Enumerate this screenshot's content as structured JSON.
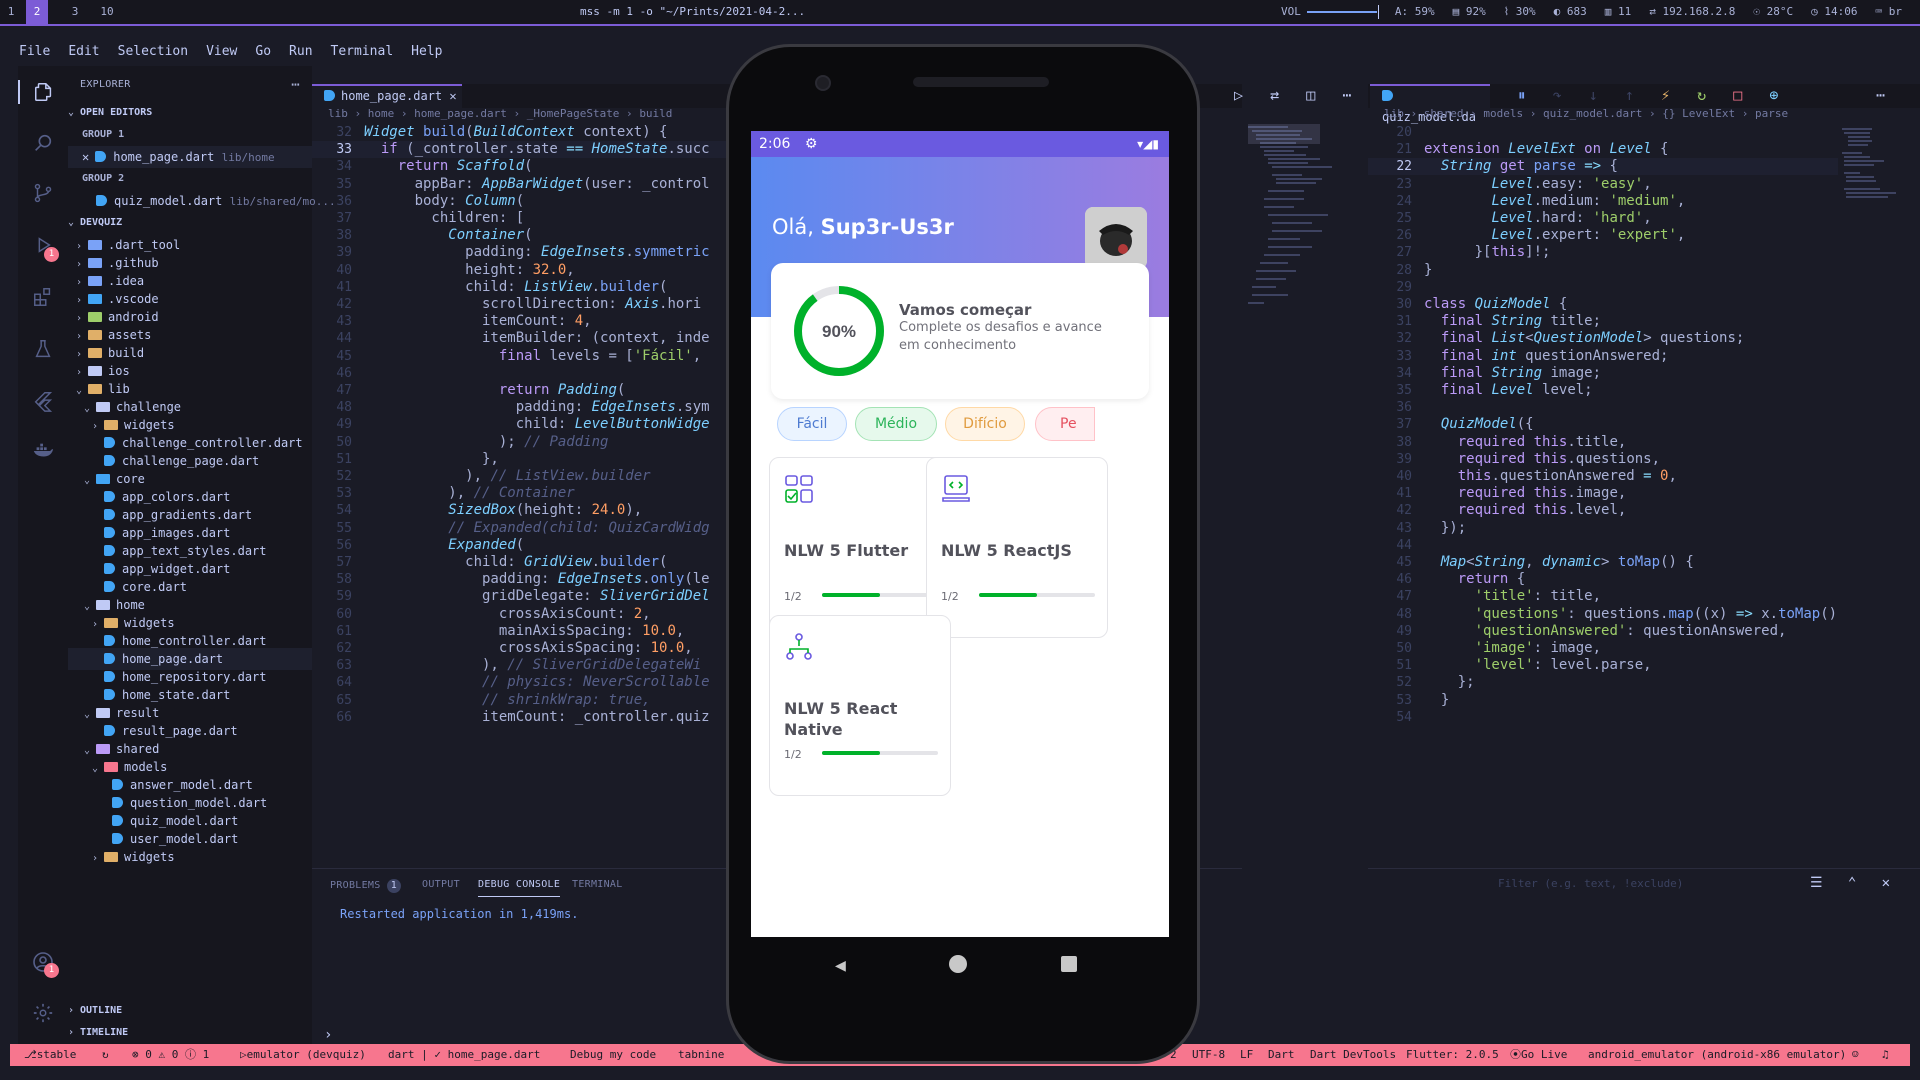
{
  "topbar": {
    "workspaces": [
      "1",
      "2",
      "3",
      "10"
    ],
    "active_workspace": "2",
    "title": "mss -m 1 -o \"~/Prints/2021-04-2...",
    "vol_label": "VOL",
    "stats": [
      "A: 59%",
      "▤ 92%",
      "⌇ 30%",
      "◐ 683",
      "▥ 11",
      "⇄ 192.168.2.8",
      "☉ 28°C",
      "◷ 14:06",
      "⌨ br"
    ]
  },
  "menu": [
    "File",
    "Edit",
    "Selection",
    "View",
    "Go",
    "Run",
    "Terminal",
    "Help"
  ],
  "activity": {
    "scm_badge": "",
    "run_badge": "1",
    "account_badge": "1"
  },
  "explorer": {
    "title": "EXPLORER",
    "open_editors": "OPEN EDITORS",
    "group1": "GROUP 1",
    "group1_file": "home_page.dart",
    "group1_path": "lib/home",
    "group2": "GROUP 2",
    "group2_file": "quiz_model.dart",
    "group2_path": "lib/shared/mo...",
    "project": "DEVQUIZ",
    "tree": [
      {
        "label": ".dart_tool",
        "kind": "folder",
        "depth": 1,
        "open": false
      },
      {
        "label": ".github",
        "kind": "folder",
        "depth": 1,
        "open": false
      },
      {
        "label": ".idea",
        "kind": "folder",
        "depth": 1,
        "open": false
      },
      {
        "label": ".vscode",
        "kind": "folder",
        "depth": 1,
        "open": false
      },
      {
        "label": "android",
        "kind": "folder",
        "depth": 1,
        "open": false
      },
      {
        "label": "assets",
        "kind": "folder",
        "depth": 1,
        "open": false
      },
      {
        "label": "build",
        "kind": "folder",
        "depth": 1,
        "open": false
      },
      {
        "label": "ios",
        "kind": "folder",
        "depth": 1,
        "open": false
      },
      {
        "label": "lib",
        "kind": "folder",
        "depth": 1,
        "open": true
      },
      {
        "label": "challenge",
        "kind": "folder",
        "depth": 2,
        "open": true
      },
      {
        "label": "widgets",
        "kind": "folder",
        "depth": 3,
        "open": false
      },
      {
        "label": "challenge_controller.dart",
        "kind": "dart",
        "depth": 3
      },
      {
        "label": "challenge_page.dart",
        "kind": "dart",
        "depth": 3
      },
      {
        "label": "core",
        "kind": "folder",
        "depth": 2,
        "open": true
      },
      {
        "label": "app_colors.dart",
        "kind": "dart",
        "depth": 3
      },
      {
        "label": "app_gradients.dart",
        "kind": "dart",
        "depth": 3
      },
      {
        "label": "app_images.dart",
        "kind": "dart",
        "depth": 3
      },
      {
        "label": "app_text_styles.dart",
        "kind": "dart",
        "depth": 3
      },
      {
        "label": "app_widget.dart",
        "kind": "dart",
        "depth": 3
      },
      {
        "label": "core.dart",
        "kind": "dart",
        "depth": 3
      },
      {
        "label": "home",
        "kind": "folder",
        "depth": 2,
        "open": true
      },
      {
        "label": "widgets",
        "kind": "folder",
        "depth": 3,
        "open": false
      },
      {
        "label": "home_controller.dart",
        "kind": "dart",
        "depth": 3
      },
      {
        "label": "home_page.dart",
        "kind": "dart",
        "depth": 3,
        "selected": true
      },
      {
        "label": "home_repository.dart",
        "kind": "dart",
        "depth": 3
      },
      {
        "label": "home_state.dart",
        "kind": "dart",
        "depth": 3
      },
      {
        "label": "result",
        "kind": "folder",
        "depth": 2,
        "open": true
      },
      {
        "label": "result_page.dart",
        "kind": "dart",
        "depth": 3
      },
      {
        "label": "shared",
        "kind": "folder",
        "depth": 2,
        "open": true
      },
      {
        "label": "models",
        "kind": "folder",
        "depth": 3,
        "open": true
      },
      {
        "label": "answer_model.dart",
        "kind": "dart",
        "depth": 4
      },
      {
        "label": "question_model.dart",
        "kind": "dart",
        "depth": 4
      },
      {
        "label": "quiz_model.dart",
        "kind": "dart",
        "depth": 4
      },
      {
        "label": "user_model.dart",
        "kind": "dart",
        "depth": 4
      },
      {
        "label": "widgets",
        "kind": "folder",
        "depth": 3,
        "open": false
      }
    ],
    "outline": "OUTLINE",
    "timeline": "TIMELINE"
  },
  "editor1": {
    "tab": "home_page.dart",
    "breadcrumb": [
      "lib",
      "home",
      "home_page.dart",
      "_HomePageState",
      "build"
    ],
    "current_line": "33",
    "lines": [
      {
        "n": "32",
        "html": "<span class='t'>Widget</span> <span class='f'>build</span>(<span class='t'>BuildContext</span> context) {"
      },
      {
        "n": "33",
        "html": "  <span class='k'>if</span> (_controller.state <span class='o'>==</span> <span class='t'>HomeState</span>.succ"
      },
      {
        "n": "34",
        "html": "    <span class='k'>return</span> <span class='t'>Scaffold</span>("
      },
      {
        "n": "35",
        "html": "      appBar: <span class='t'>AppBarWidget</span>(user: _control"
      },
      {
        "n": "36",
        "html": "      body: <span class='t'>Column</span>("
      },
      {
        "n": "37",
        "html": "        children: ["
      },
      {
        "n": "38",
        "html": "          <span class='t'>Container</span>("
      },
      {
        "n": "39",
        "html": "            padding: <span class='t'>EdgeInsets</span>.<span class='f'>symmetric</span>"
      },
      {
        "n": "40",
        "html": "            height: <span class='n'>32.0</span>,"
      },
      {
        "n": "41",
        "html": "            child: <span class='t'>ListView</span>.<span class='f'>builder</span>("
      },
      {
        "n": "42",
        "html": "              scrollDirection: <span class='t'>Axis</span>.hori"
      },
      {
        "n": "43",
        "html": "              itemCount: <span class='n'>4</span>,"
      },
      {
        "n": "44",
        "html": "              itemBuilder: (context, inde"
      },
      {
        "n": "45",
        "html": "                <span class='k'>final</span> levels = [<span class='s'>'Fácil'</span>,"
      },
      {
        "n": "46",
        "html": ""
      },
      {
        "n": "47",
        "html": "                <span class='k'>return</span> <span class='t'>Padding</span>("
      },
      {
        "n": "48",
        "html": "                  padding: <span class='t'>EdgeInsets</span>.sym"
      },
      {
        "n": "49",
        "html": "                  child: <span class='t'>LevelButtonWidge</span>"
      },
      {
        "n": "50",
        "html": "                ); <span class='c'>// Padding</span>"
      },
      {
        "n": "51",
        "html": "              },"
      },
      {
        "n": "52",
        "html": "            ), <span class='c'>// ListView.builder</span>"
      },
      {
        "n": "53",
        "html": "          ), <span class='c'>// Container</span>"
      },
      {
        "n": "54",
        "html": "          <span class='t'>SizedBox</span>(height: <span class='n'>24.0</span>),"
      },
      {
        "n": "55",
        "html": "          <span class='c'>// Expanded(child: QuizCardWidg</span>"
      },
      {
        "n": "56",
        "html": "          <span class='t'>Expanded</span>("
      },
      {
        "n": "57",
        "html": "            child: <span class='t'>GridView</span>.<span class='f'>builder</span>("
      },
      {
        "n": "58",
        "html": "              padding: <span class='t'>EdgeInsets</span>.<span class='f'>only</span>(le"
      },
      {
        "n": "59",
        "html": "              gridDelegate: <span class='t'>SliverGridDel</span>"
      },
      {
        "n": "60",
        "html": "                crossAxisCount: <span class='n'>2</span>,"
      },
      {
        "n": "61",
        "html": "                mainAxisSpacing: <span class='n'>10.0</span>,"
      },
      {
        "n": "62",
        "html": "                crossAxisSpacing: <span class='n'>10.0</span>,"
      },
      {
        "n": "63",
        "html": "              ), <span class='c'>// SliverGridDelegateWi</span>"
      },
      {
        "n": "64",
        "html": "              <span class='c'>// physics: NeverScrollable</span>"
      },
      {
        "n": "65",
        "html": "              <span class='c'>// shrinkWrap: true,</span>"
      },
      {
        "n": "66",
        "html": "              itemCount: _controller.quiz"
      }
    ]
  },
  "panel": {
    "tabs": [
      "PROBLEMS",
      "OUTPUT",
      "DEBUG CONSOLE",
      "TERMINAL"
    ],
    "active_tab": "DEBUG CONSOLE",
    "problems_count": "1",
    "console_text": "Restarted application in 1,419ms.",
    "filter_placeholder": "Filter (e.g. text, !exclude)"
  },
  "editor2": {
    "tab": "quiz_model.da",
    "breadcrumb": [
      "lib",
      "shared",
      "models",
      "quiz_model.dart",
      "{} LevelExt",
      "parse"
    ],
    "current_line": "22",
    "lines": [
      {
        "n": "20",
        "html": ""
      },
      {
        "n": "21",
        "html": "<span class='k'>extension</span> <span class='t'>LevelExt</span> <span class='k'>on</span> <span class='t'>Level</span> {"
      },
      {
        "n": "22",
        "html": "  <span class='t'>String</span> <span class='k'>get</span> <span class='f'>parse</span> <span class='o'>=&gt;</span> {"
      },
      {
        "n": "23",
        "html": "        <span class='t'>Level</span>.easy: <span class='s'>'easy'</span>,"
      },
      {
        "n": "24",
        "html": "        <span class='t'>Level</span>.medium: <span class='s'>'medium'</span>,"
      },
      {
        "n": "25",
        "html": "        <span class='t'>Level</span>.hard: <span class='s'>'hard'</span>,"
      },
      {
        "n": "26",
        "html": "        <span class='t'>Level</span>.expert: <span class='s'>'expert'</span>,"
      },
      {
        "n": "27",
        "html": "      }[<span class='k'>this</span>]!;"
      },
      {
        "n": "28",
        "html": "}"
      },
      {
        "n": "29",
        "html": ""
      },
      {
        "n": "30",
        "html": "<span class='k'>class</span> <span class='t'>QuizModel</span> {"
      },
      {
        "n": "31",
        "html": "  <span class='k'>final</span> <span class='t'>String</span> title;"
      },
      {
        "n": "32",
        "html": "  <span class='k'>final</span> <span class='t'>List</span>&lt;<span class='t'>QuestionModel</span>&gt; questions;"
      },
      {
        "n": "33",
        "html": "  <span class='k'>final</span> <span class='t'>int</span> questionAnswered;"
      },
      {
        "n": "34",
        "html": "  <span class='k'>final</span> <span class='t'>String</span> image;"
      },
      {
        "n": "35",
        "html": "  <span class='k'>final</span> <span class='t'>Level</span> level;"
      },
      {
        "n": "36",
        "html": ""
      },
      {
        "n": "37",
        "html": "  <span class='t'>QuizModel</span>({"
      },
      {
        "n": "38",
        "html": "    <span class='k'>required</span> <span class='k'>this</span>.title,"
      },
      {
        "n": "39",
        "html": "    <span class='k'>required</span> <span class='k'>this</span>.questions,"
      },
      {
        "n": "40",
        "html": "    <span class='k'>this</span>.questionAnswered <span class='o'>=</span> <span class='n'>0</span>,"
      },
      {
        "n": "41",
        "html": "    <span class='k'>required</span> <span class='k'>this</span>.image,"
      },
      {
        "n": "42",
        "html": "    <span class='k'>required</span> <span class='k'>this</span>.level,"
      },
      {
        "n": "43",
        "html": "  });"
      },
      {
        "n": "44",
        "html": ""
      },
      {
        "n": "45",
        "html": "  <span class='t'>Map</span>&lt;<span class='t'>String</span>, <span class='t'>dynamic</span>&gt; <span class='f'>toMap</span>() {"
      },
      {
        "n": "46",
        "html": "    <span class='k'>return</span> {"
      },
      {
        "n": "47",
        "html": "      <span class='s'>'title'</span>: title,"
      },
      {
        "n": "48",
        "html": "      <span class='s'>'questions'</span>: questions.<span class='f'>map</span>((x) <span class='o'>=&gt;</span> x.<span class='f'>toMap</span>()"
      },
      {
        "n": "49",
        "html": "      <span class='s'>'questionAnswered'</span>: questionAnswered,"
      },
      {
        "n": "50",
        "html": "      <span class='s'>'image'</span>: image,"
      },
      {
        "n": "51",
        "html": "      <span class='s'>'level'</span>: level.parse,"
      },
      {
        "n": "52",
        "html": "    };"
      },
      {
        "n": "53",
        "html": "  }"
      },
      {
        "n": "54",
        "html": ""
      }
    ]
  },
  "phone": {
    "time": "2:06",
    "greeting": "Olá, ",
    "username": "Sup3r-Us3r",
    "progress_value": 0.9,
    "progress_label": "90%",
    "card_title": "Vamos começar",
    "card_subtitle": "Complete os desafios e avance em conhecimento",
    "levels": [
      {
        "label": "Fácil",
        "bg": "#ebf4ff",
        "border": "#b8d4ff",
        "color": "#4e7bd1"
      },
      {
        "label": "Médio",
        "bg": "#e6f9ec",
        "border": "#a4e3b5",
        "color": "#2cb45a"
      },
      {
        "label": "Difício",
        "bg": "#fff4e6",
        "border": "#ffd9a6",
        "color": "#e09b3f"
      },
      {
        "label": "Pe",
        "bg": "#ffeef0",
        "border": "#ffc2c8",
        "color": "#e5505f"
      }
    ],
    "quizzes": [
      {
        "title": "NLW 5 Flutter",
        "count": "1/2",
        "progress": 0.5,
        "icon": "blocks-icon"
      },
      {
        "title": "NLW 5 ReactJS",
        "count": "1/2",
        "progress": 0.5,
        "icon": "laptop-code-icon"
      },
      {
        "title": "NLW 5 React Native",
        "count": "1/2",
        "progress": 0.5,
        "icon": "hierarchy-icon"
      }
    ]
  },
  "statusbar": {
    "items": [
      "stable",
      "↻",
      "⊗ 0 ⚠ 0 ⓘ 1",
      "emulator (devquiz)",
      "dart | ✓ home_page.dart",
      "Debug my code",
      "tabnine",
      "2",
      "UTF-8",
      "LF",
      "Dart",
      "Dart DevTools",
      "Flutter: 2.0.5",
      "Go Live",
      "android_emulator (android-x86 emulator)"
    ]
  },
  "colors": {
    "accent": "#7c5cd6",
    "status": "#f7768e",
    "ring": "#00b12a",
    "purple": "#6a5ae0"
  }
}
